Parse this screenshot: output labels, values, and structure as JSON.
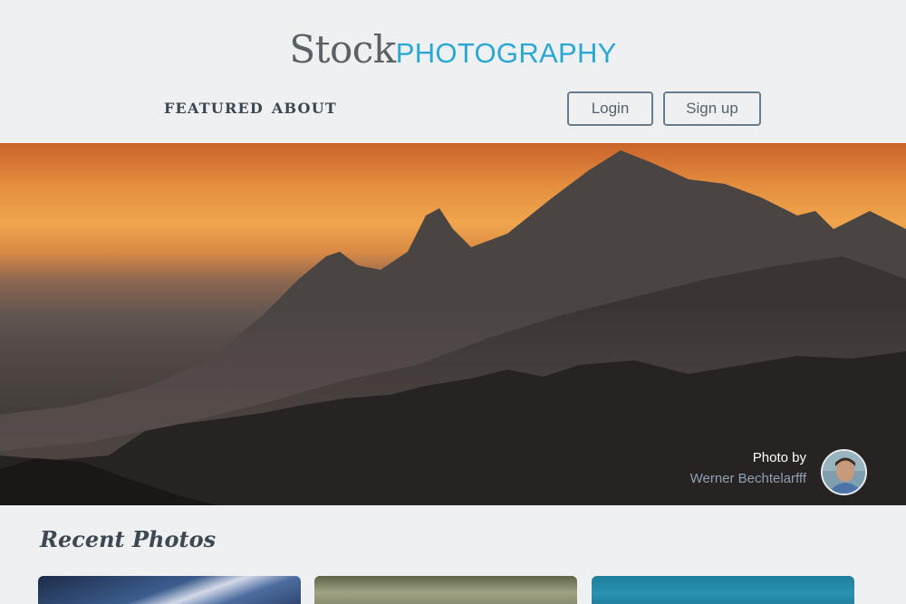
{
  "header": {
    "logo_primary": "Stock",
    "logo_secondary": "PHOTOGRAPHY",
    "nav": [
      {
        "label": "FEATURED"
      },
      {
        "label": "ABOUT"
      }
    ],
    "login_label": "Login",
    "signup_label": "Sign up"
  },
  "hero": {
    "credit_label": "Photo by",
    "credit_name": "Werner Bechtelarfff"
  },
  "recent": {
    "title": "Recent Photos"
  },
  "colors": {
    "background": "#eef0f2",
    "accent": "#2aa8d4",
    "logo_gray": "#5b6266",
    "button_border": "#6b7c88"
  }
}
